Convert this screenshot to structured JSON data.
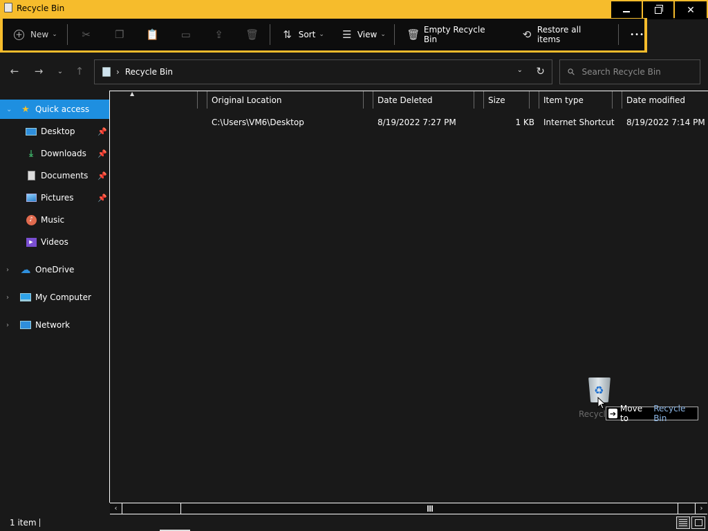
{
  "window": {
    "title": "Recycle Bin",
    "minimize_icon": "minimize-icon",
    "maximize_icon": "restore-icon",
    "close_glyph": "✕"
  },
  "toolbar": {
    "new_label": "New",
    "sort_label": "Sort",
    "view_label": "View",
    "empty_label": "Empty Recycle Bin",
    "restore_label": "Restore all items",
    "more_glyph": "•••",
    "disabled_icons": [
      "cut-icon",
      "copy-icon",
      "paste-icon",
      "rename-icon",
      "share-icon",
      "delete-icon"
    ]
  },
  "address": {
    "path": "Recycle Bin",
    "search_placeholder": "Search Recycle Bin"
  },
  "sidebar": {
    "items": [
      {
        "label": "Quick access",
        "icon": "star-icon",
        "selected": true
      },
      {
        "label": "Desktop",
        "icon": "desktop-icon",
        "pinned": true
      },
      {
        "label": "Downloads",
        "icon": "download-icon",
        "pinned": true
      },
      {
        "label": "Documents",
        "icon": "document-icon",
        "pinned": true
      },
      {
        "label": "Pictures",
        "icon": "pictures-icon",
        "pinned": true
      },
      {
        "label": "Music",
        "icon": "music-icon"
      },
      {
        "label": "Videos",
        "icon": "videos-icon"
      },
      {
        "label": "OneDrive",
        "icon": "cloud-icon"
      },
      {
        "label": "My Computer",
        "icon": "computer-icon"
      },
      {
        "label": "Network",
        "icon": "network-icon"
      }
    ]
  },
  "columns": [
    "Original Location",
    "Date Deleted",
    "Size",
    "Item type",
    "Date modified"
  ],
  "rows": [
    {
      "name": "",
      "original_location": "C:\\Users\\VM6\\Desktop",
      "date_deleted": "8/19/2022 7:27 PM",
      "size": "1 KB",
      "item_type": "Internet Shortcut",
      "date_modified": "8/19/2022 7:14 PM"
    }
  ],
  "drag": {
    "ghost_label": "Recycl",
    "tooltip_action": "Move to",
    "tooltip_target": "Recycle Bin"
  },
  "status": {
    "item_count": "1 item"
  },
  "colors": {
    "accent_frame": "#f6bc2c",
    "selection": "#1e8fe0",
    "background": "#191919"
  }
}
